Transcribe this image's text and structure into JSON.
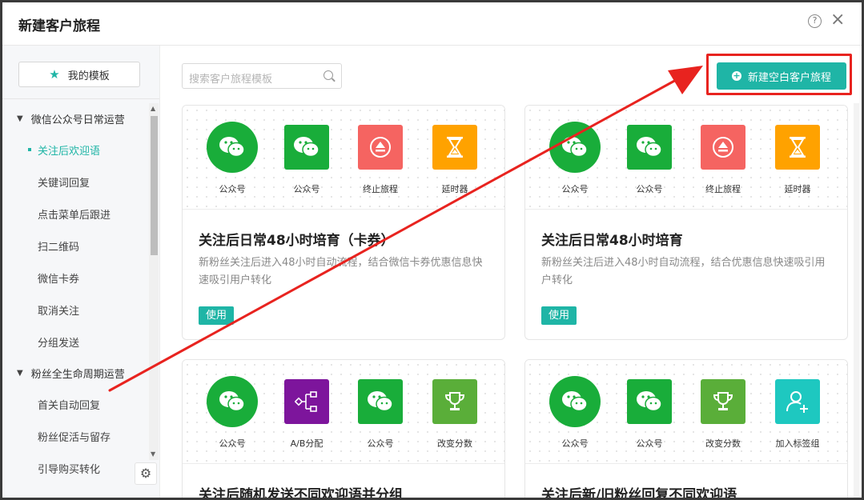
{
  "dialog": {
    "title": "新建客户旅程",
    "help_label": "?",
    "close_label": "×"
  },
  "sidebar": {
    "my_templates_label": "我的模板",
    "groups": [
      {
        "label": "微信公众号日常运营",
        "items": [
          "关注后欢迎语",
          "关键词回复",
          "点击菜单后跟进",
          "扫二维码",
          "微信卡券",
          "取消关注",
          "分组发送"
        ]
      },
      {
        "label": "粉丝全生命周期运营",
        "items": [
          "首关自动回复",
          "粉丝促活与留存",
          "引导购买转化"
        ]
      }
    ],
    "active_item": "关注后欢迎语",
    "gear_icon": "⚙"
  },
  "search": {
    "placeholder": "搜索客户旅程模板"
  },
  "new_button": {
    "label": "新建空白客户旅程"
  },
  "colors": {
    "accent": "#1fb5a6",
    "wechat_green": "#19ad3a",
    "stop_red": "#f56461",
    "delay_orange": "#ffa200",
    "ab_purple": "#7d159c",
    "score_green": "#5aae39",
    "tag_teal": "#1ec8c0",
    "annotation_red": "#e8231f"
  },
  "cards": [
    {
      "nodes": [
        {
          "icon": "wechat-icon",
          "label": "公众号",
          "shape": "circle",
          "color": "#19ad3a"
        },
        {
          "icon": "wechat-icon",
          "label": "公众号",
          "shape": "square",
          "color": "#19ad3a"
        },
        {
          "icon": "eject-icon",
          "label": "终止旅程",
          "shape": "square",
          "color": "#f56461"
        },
        {
          "icon": "hourglass-icon",
          "label": "延时器",
          "shape": "square",
          "color": "#ffa200"
        }
      ],
      "title": "关注后日常48小时培育（卡券）",
      "desc": "新粉丝关注后进入48小时自动流程，结合微信卡券优惠信息快速吸引用户转化",
      "use_label": "使用"
    },
    {
      "nodes": [
        {
          "icon": "wechat-icon",
          "label": "公众号",
          "shape": "circle",
          "color": "#19ad3a"
        },
        {
          "icon": "wechat-icon",
          "label": "公众号",
          "shape": "square",
          "color": "#19ad3a"
        },
        {
          "icon": "eject-icon",
          "label": "终止旅程",
          "shape": "square",
          "color": "#f56461"
        },
        {
          "icon": "hourglass-icon",
          "label": "延时器",
          "shape": "square",
          "color": "#ffa200"
        }
      ],
      "title": "关注后日常48小时培育",
      "desc": "新粉丝关注后进入48小时自动流程，结合优惠信息快速吸引用户转化",
      "use_label": "使用"
    },
    {
      "nodes": [
        {
          "icon": "wechat-icon",
          "label": "公众号",
          "shape": "circle",
          "color": "#19ad3a"
        },
        {
          "icon": "ab-split-icon",
          "label": "A/B分配",
          "shape": "square",
          "color": "#7d159c"
        },
        {
          "icon": "wechat-icon",
          "label": "公众号",
          "shape": "square",
          "color": "#19ad3a"
        },
        {
          "icon": "trophy-icon",
          "label": "改变分数",
          "shape": "square",
          "color": "#5aae39"
        }
      ],
      "title": "关注后随机发送不同欢迎语并分组",
      "desc": "",
      "use_label": ""
    },
    {
      "nodes": [
        {
          "icon": "wechat-icon",
          "label": "公众号",
          "shape": "circle",
          "color": "#19ad3a"
        },
        {
          "icon": "wechat-icon",
          "label": "公众号",
          "shape": "square",
          "color": "#19ad3a"
        },
        {
          "icon": "trophy-icon",
          "label": "改变分数",
          "shape": "square",
          "color": "#5aae39"
        },
        {
          "icon": "add-tag-icon",
          "label": "加入标签组",
          "shape": "square",
          "color": "#1ec8c0"
        }
      ],
      "title": "关注后新/旧粉丝回复不同欢迎语",
      "desc": "",
      "use_label": ""
    }
  ]
}
